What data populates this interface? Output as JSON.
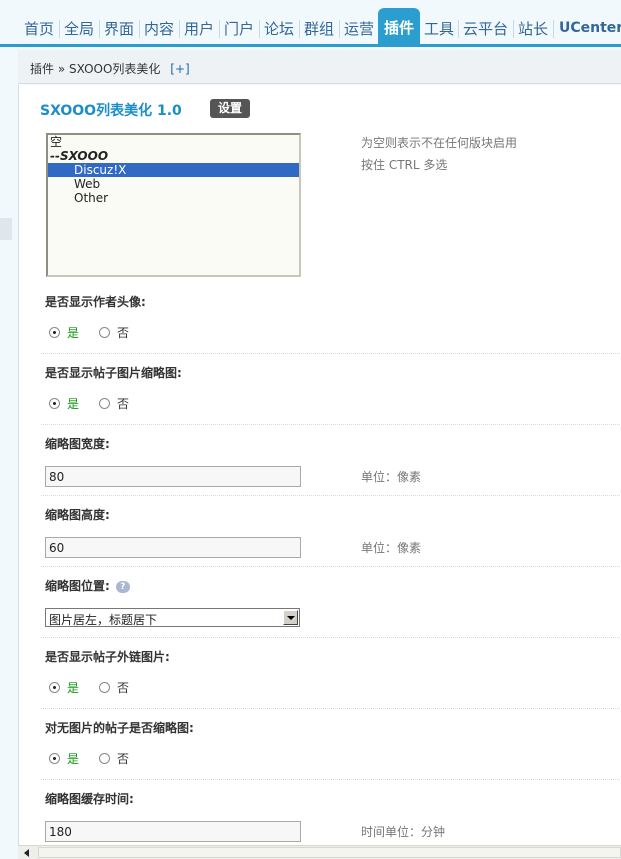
{
  "nav": {
    "items": [
      "首页",
      "全局",
      "界面",
      "内容",
      "用户",
      "门户",
      "论坛",
      "群组",
      "运营",
      "插件",
      "工具",
      "云平台",
      "站长",
      "UCenter"
    ],
    "active": "插件",
    "accent_color": "#2b9ecf"
  },
  "breadcrumb": {
    "root": "插件",
    "separator": "»",
    "current": "SXOOO列表美化",
    "add_label": "[+]"
  },
  "plugin": {
    "title": "SXOOO列表美化  1.0",
    "settings_label": "设置"
  },
  "board_select": {
    "options": [
      {
        "label": "空",
        "type": "option"
      },
      {
        "label": "--SXOOO",
        "type": "group"
      },
      {
        "label": "Discuz!X",
        "type": "child",
        "selected": true
      },
      {
        "label": "Web",
        "type": "child"
      },
      {
        "label": "Other",
        "type": "child"
      }
    ],
    "hint_line1": "为空则表示不在任何版块启用",
    "hint_line2": "按住  CTRL 多选"
  },
  "fields": {
    "show_avatar": {
      "label": "是否显示作者头像:",
      "yes": "是",
      "no": "否",
      "value": "yes"
    },
    "show_thumb": {
      "label": "是否显示帖子图片缩略图:",
      "yes": "是",
      "no": "否",
      "value": "yes"
    },
    "thumb_width": {
      "label": "缩略图宽度:",
      "value": "80",
      "unit": "单位：像素"
    },
    "thumb_height": {
      "label": "缩略图高度:",
      "value": "60",
      "unit": "单位：像素"
    },
    "thumb_position": {
      "label": "缩略图位置:",
      "help_icon": "question-bubble-icon",
      "value": "图片居左，标题居下"
    },
    "show_external": {
      "label": "是否显示帖子外链图片:",
      "yes": "是",
      "no": "否",
      "value": "yes"
    },
    "no_image_thumb": {
      "label": "对无图片的帖子是否缩略图:",
      "yes": "是",
      "no": "否",
      "value": "yes"
    },
    "cache_time": {
      "label": "缩略图缓存时间:",
      "value": "180",
      "unit": "时间单位：分钟"
    }
  }
}
